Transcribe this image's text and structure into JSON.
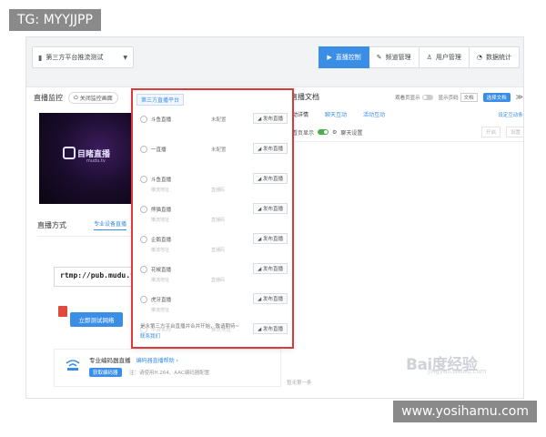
{
  "watermark_top": "TG: MYYJJPP",
  "watermark_bottom": "www.yosihamu.com",
  "header": {
    "channel": "第三方平台推流测试",
    "nav": [
      {
        "label": "直播控制",
        "icon": "play-icon",
        "active": true
      },
      {
        "label": "频道管理",
        "icon": "edit-icon",
        "active": false
      },
      {
        "label": "用户管理",
        "icon": "user-icon",
        "active": false
      },
      {
        "label": "数据统计",
        "icon": "stats-icon",
        "active": false
      }
    ]
  },
  "monitor": {
    "title": "直播监控",
    "refresh": "关闭监控画面",
    "video_logo": "目睹直播",
    "video_sub": "mudu.tv"
  },
  "stream": {
    "title": "直播方式",
    "tab": "专业设备直播",
    "rtmp": "rtmp://pub.mudu.tv/w",
    "test_button": "立即测试网络",
    "hw_title": "专业编码器直播",
    "hw_link": "编码器直播帮助 ›",
    "hw_download": "获取编码器",
    "hw_note": "注：请使用H.264、AAC编码器配置"
  },
  "doc": {
    "title": "直播文档",
    "toggle_label": "观看页显示",
    "page_label": "显示页码",
    "page_value": "文档",
    "select_button": "选择文档",
    "chev": "≫"
  },
  "interaction": {
    "tab1": "互动详情",
    "tab2": "聊天互动",
    "tab3": "活动互动",
    "link": "设定互动条›",
    "row2_label": "聊天设置",
    "row2_prefix": "观看页显示",
    "row2_btn1": "开启",
    "row2_btn2": "设置",
    "bottom": "暂无第一条"
  },
  "popup": {
    "header": "第三方直播平台",
    "rows": [
      {
        "name": "斗鱼直播",
        "status": "未配置",
        "sub": "",
        "sub2": "",
        "btn": "发布直播",
        "ghost": false
      },
      {
        "name": "一直播",
        "status": "未配置",
        "sub": "",
        "sub2": "",
        "btn": "发布直播",
        "ghost": false
      },
      {
        "name": "斗鱼直播",
        "status": "",
        "sub": "推流地址",
        "sub2": "直播码",
        "btn": "发布直播",
        "ghost": false
      },
      {
        "name": "熊猫直播",
        "status": "",
        "sub": "推流地址",
        "sub2": "直播码",
        "btn": "发布直播",
        "ghost": false
      },
      {
        "name": "企鹅直播",
        "status": "",
        "sub": "推流地址",
        "sub2": "直播码",
        "btn": "发布直播",
        "ghost": false
      },
      {
        "name": "花椒直播",
        "status": "",
        "sub": "推流地址",
        "sub2": "直播码",
        "btn": "发布直播",
        "ghost": false
      },
      {
        "name": "虎牙直播",
        "status": "",
        "sub": "推流地址",
        "sub2": "",
        "btn": "发布直播",
        "ghost": false
      },
      {
        "name": "平台名称",
        "status": "推流地址",
        "sub": "",
        "sub2": "",
        "btn": "发布直播",
        "ghost": true
      }
    ],
    "footer": "是永第三方平台直播并合并开始，敬请期待~",
    "footer_link": "联系我们"
  },
  "baidu_mark": "Bai度经验",
  "baidu_sub": "jingyan.baidu.com"
}
